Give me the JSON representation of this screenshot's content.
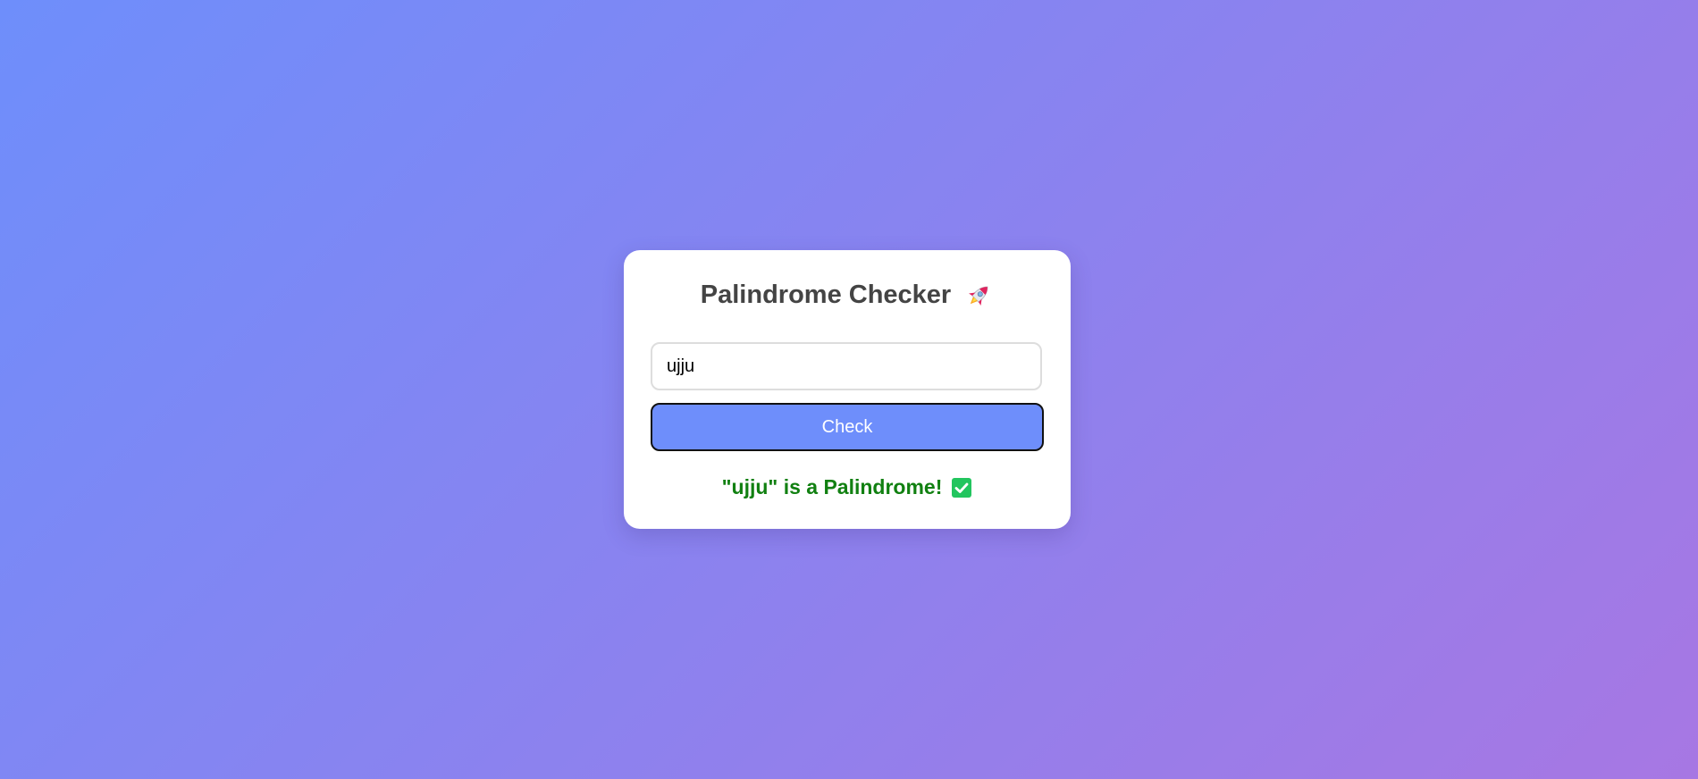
{
  "app": {
    "title": "Palindrome Checker",
    "title_icon": "rocket-icon"
  },
  "form": {
    "input_value": "ujju",
    "check_label": "Check"
  },
  "result": {
    "message": "\"ujju\" is a Palindrome!",
    "status_icon": "check-mark-icon",
    "status_color": "#118011"
  },
  "colors": {
    "background_start": "#6e8efb",
    "background_end": "#a777e3",
    "button": "#6e8efb"
  }
}
